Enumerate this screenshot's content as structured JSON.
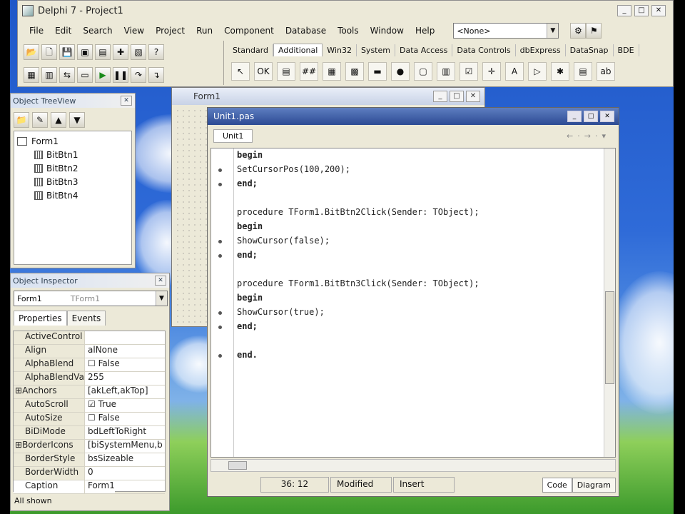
{
  "main": {
    "title": "Delphi 7 - Project1",
    "menu": [
      "File",
      "Edit",
      "Search",
      "View",
      "Project",
      "Run",
      "Component",
      "Database",
      "Tools",
      "Window",
      "Help"
    ],
    "combo_value": "<None>",
    "toolbar_icons": [
      "open-icon",
      "new-icon",
      "save-icon",
      "save-all-icon",
      "open-project-icon",
      "add-file-icon",
      "remove-file-icon",
      "run-icon",
      "pause-icon",
      "step-icon",
      "trace-icon"
    ],
    "palette_tabs": [
      "Standard",
      "Additional",
      "Win32",
      "System",
      "Data Access",
      "Data Controls",
      "dbExpress",
      "DataSnap",
      "BDE"
    ],
    "palette_active": "Additional"
  },
  "tree_view": {
    "title": "Object TreeView",
    "root": "Form1",
    "items": [
      "BitBtn1",
      "BitBtn2",
      "BitBtn3",
      "BitBtn4"
    ]
  },
  "inspector": {
    "title": "Object Inspector",
    "selected": "Form1",
    "selected_type": "TForm1",
    "tabs": [
      "Properties",
      "Events"
    ],
    "rows": [
      {
        "name": "ActiveControl",
        "value": ""
      },
      {
        "name": "Align",
        "value": "alNone"
      },
      {
        "name": "AlphaBlend",
        "value": "False"
      },
      {
        "name": "AlphaBlendVal",
        "value": "255"
      },
      {
        "name": "Anchors",
        "value": "[akLeft,akTop]"
      },
      {
        "name": "AutoScroll",
        "value": "True"
      },
      {
        "name": "AutoSize",
        "value": "False"
      },
      {
        "name": "BiDiMode",
        "value": "bdLeftToRight"
      },
      {
        "name": "BorderIcons",
        "value": "[biSystemMenu,b"
      },
      {
        "name": "BorderStyle",
        "value": "bsSizeable"
      },
      {
        "name": "BorderWidth",
        "value": "0"
      },
      {
        "name": "Caption",
        "value": "Form1"
      }
    ],
    "status": "All shown"
  },
  "form_window": {
    "title": "Form1"
  },
  "editor": {
    "title": "Unit1.pas",
    "tab": "Unit1",
    "lines": [
      "begin",
      "SetCursorPos(100,200);",
      "end;",
      "",
      "procedure TForm1.BitBtn2Click(Sender: TObject);",
      "begin",
      "ShowCursor(false);",
      "end;",
      "",
      "procedure TForm1.BitBtn3Click(Sender: TObject);",
      "begin",
      "ShowCursor(true);",
      "end;",
      "",
      "end."
    ],
    "status_position": "36: 12",
    "status_modified": "Modified",
    "status_mode": "Insert",
    "bottom_tabs": [
      "Code",
      "Diagram"
    ]
  }
}
